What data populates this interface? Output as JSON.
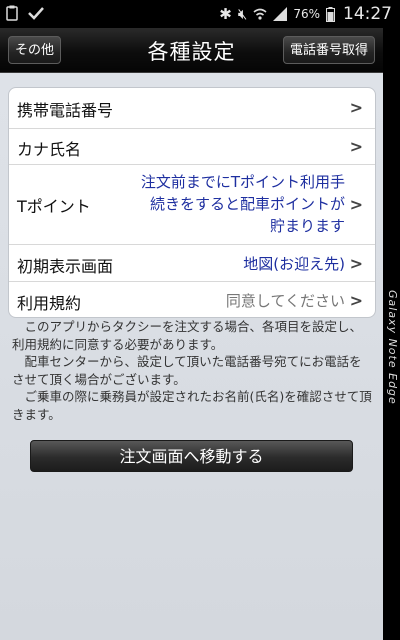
{
  "status_bar": {
    "left_icons": [
      "clipboard-icon",
      "check-icon"
    ],
    "right_icons": [
      "bluetooth-icon",
      "mute-icon",
      "wifi-icon",
      "signal-icon",
      "battery-icon"
    ],
    "battery": "76%",
    "time": "14:27"
  },
  "nav": {
    "back_label": "その他",
    "title": "各種設定",
    "action_label": "電話番号取得"
  },
  "settings": [
    {
      "label": "携帯電話番号",
      "value": ""
    },
    {
      "label": "カナ氏名",
      "value": ""
    },
    {
      "label": "Tポイント",
      "value_lines": [
        "注文前までにTポイント利用手",
        "続きをすると配車ポイントが",
        "貯まります"
      ]
    },
    {
      "label": "初期表示画面",
      "value": "地図(お迎え先)"
    },
    {
      "label": "利用規約",
      "value": "同意してください"
    }
  ],
  "chevron": ">",
  "notes": [
    "このアプリからタクシーを注文する場合、各項目を設定し、利用規約に同意する必要があります。",
    "配車センターから、設定して頂いた電話番号宛てにお電話をさせて頂く場合がございます。",
    "ご乗車の際に乗務員が設定されたお名前(氏名)を確認させて頂きます。"
  ],
  "primary_button": "注文画面へ移動する",
  "device_edge_label": "Galaxy Note Edge",
  "colors": {
    "value_blue": "#1e2fa0",
    "nav_bg": "#0d0d0d",
    "page_bg": "#d9dde3"
  }
}
